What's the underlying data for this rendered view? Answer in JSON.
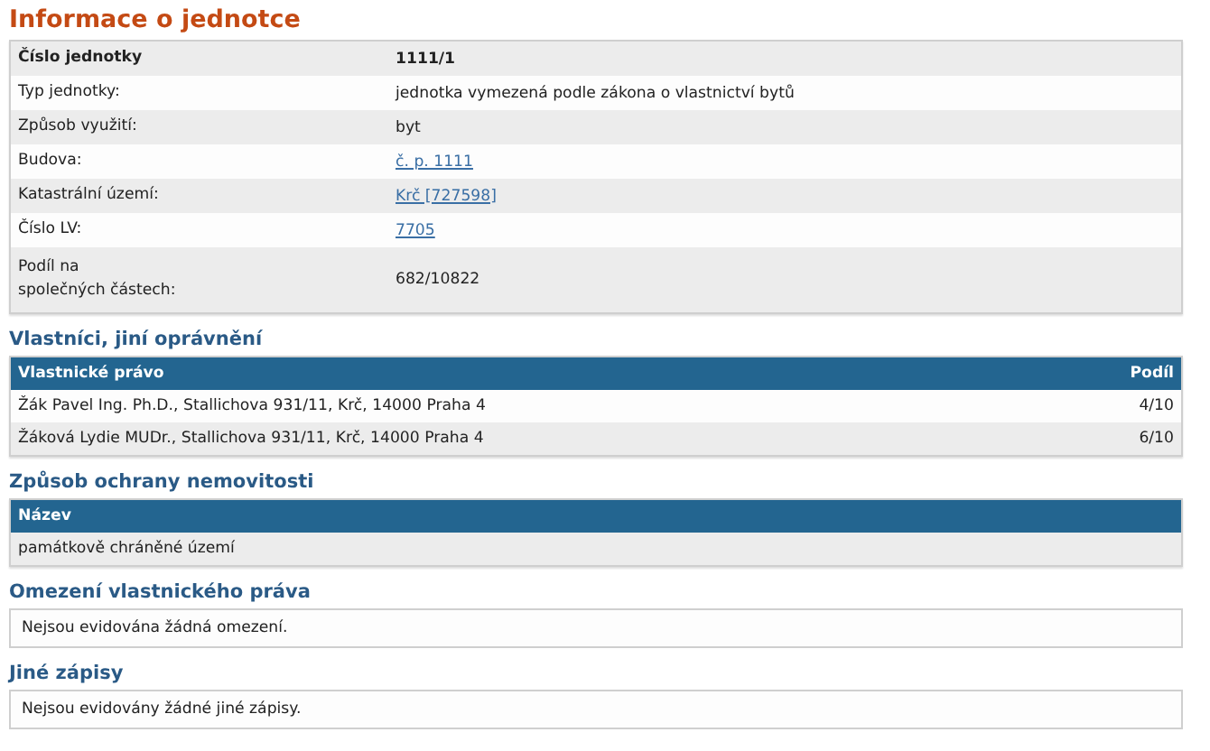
{
  "title": "Informace o jednotce",
  "info_rows": [
    {
      "kind": "header",
      "label": "Číslo jednotky",
      "value": "1111/1"
    },
    {
      "kind": "text",
      "label": "Typ jednotky:",
      "value": "jednotka vymezená podle zákona o vlastnictví bytů"
    },
    {
      "kind": "text",
      "label": "Způsob využití:",
      "value": "byt"
    },
    {
      "kind": "link",
      "label": "Budova:",
      "value": "č. p. 1111"
    },
    {
      "kind": "link",
      "label": "Katastrální území:",
      "value": "Krč [727598]"
    },
    {
      "kind": "link",
      "label": "Číslo LV:",
      "value": "7705"
    },
    {
      "kind": "text",
      "label": "Podíl na\nspolečných částech:",
      "value": "682/10822"
    }
  ],
  "owners": {
    "heading": "Vlastníci, jiní oprávnění",
    "columns": [
      "Vlastnické právo",
      "Podíl"
    ],
    "rows": [
      {
        "owner": "Žák Pavel Ing. Ph.D., Stallichova 931/11, Krč, 14000 Praha 4",
        "share": "4/10"
      },
      {
        "owner": "Žáková Lydie MUDr., Stallichova 931/11, Krč, 14000 Praha 4",
        "share": "6/10"
      }
    ]
  },
  "protection": {
    "heading": "Způsob ochrany nemovitosti",
    "columns": [
      "Název"
    ],
    "rows": [
      {
        "name": "památkově chráněné území"
      }
    ]
  },
  "notes": [
    {
      "heading": "Omezení vlastnického práva",
      "text": "Nejsou evidována žádná omezení."
    },
    {
      "heading": "Jiné zápisy",
      "text": "Nejsou evidovány žádné jiné zápisy."
    }
  ]
}
